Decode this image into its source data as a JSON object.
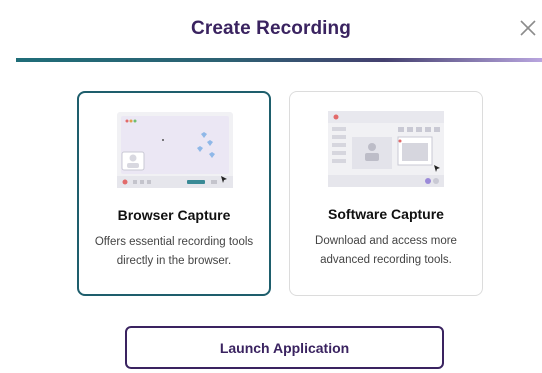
{
  "dialog": {
    "title": "Create Recording",
    "close_icon": "close-icon"
  },
  "options": [
    {
      "title": "Browser Capture",
      "description": "Offers essential recording tools directly in the browser.",
      "selected": true,
      "illustration": "browser-capture-illustration"
    },
    {
      "title": "Software Capture",
      "description": "Download and access more advanced recording tools.",
      "selected": false,
      "illustration": "software-capture-illustration"
    }
  ],
  "actions": {
    "launch_label": "Launch Application"
  },
  "colors": {
    "title": "#3a2360",
    "selected_border": "#1e5e6c",
    "unselected_border": "#dcdcdc"
  }
}
